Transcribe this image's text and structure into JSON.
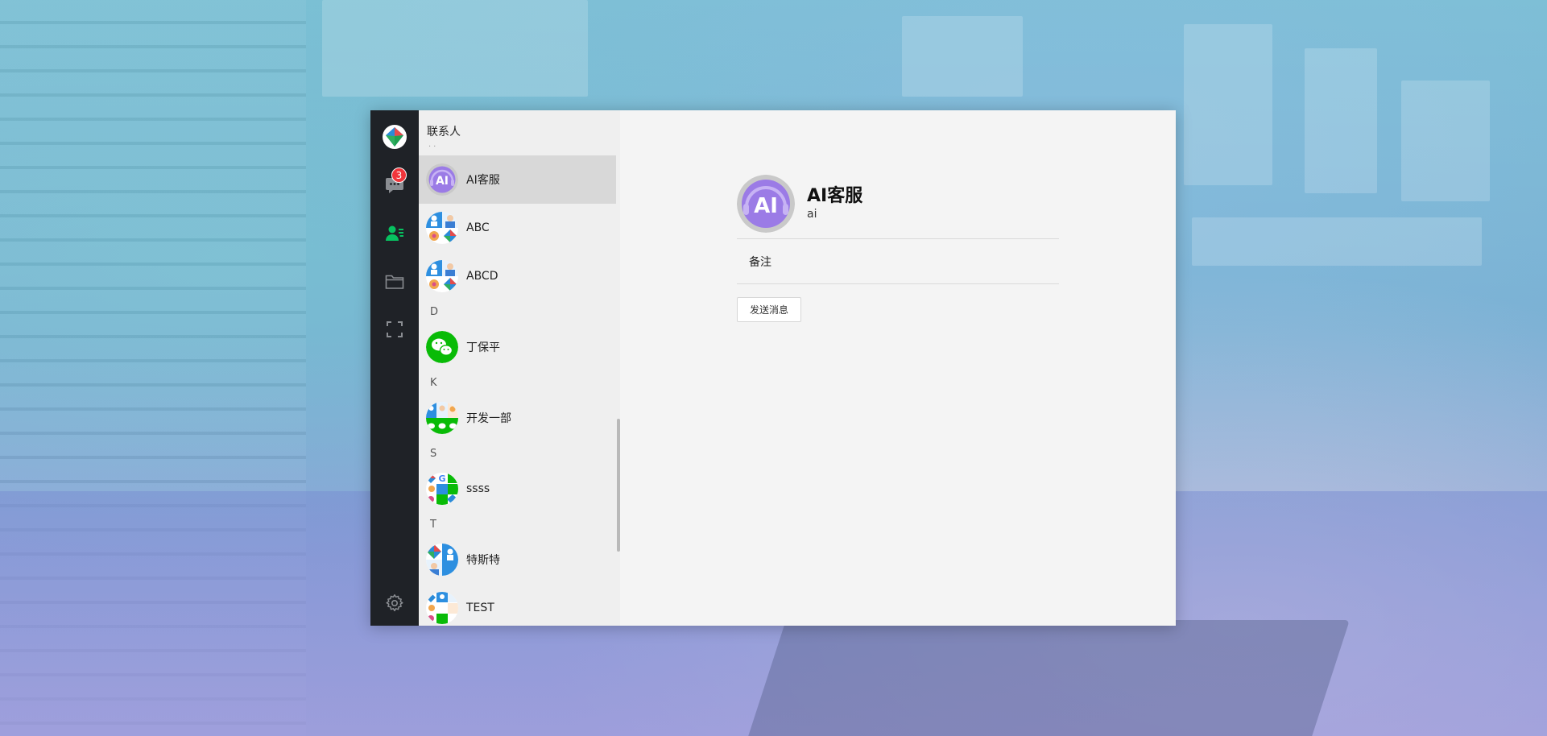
{
  "colors": {
    "nav_bg": "#1f2227",
    "accent_green": "#07c160",
    "badge_red": "#f0353b",
    "list_bg": "#efefef",
    "active_row": "#d8d8d8",
    "detail_bg": "#f4f4f4",
    "ai_purple": "#9b7be6"
  },
  "nav": {
    "items": [
      {
        "icon": "app-logo-icon"
      },
      {
        "icon": "chat-bubble-icon",
        "badge": "3"
      },
      {
        "icon": "contacts-icon",
        "active": true
      },
      {
        "icon": "folder-icon"
      },
      {
        "icon": "fullscreen-icon"
      },
      {
        "icon": "gear-icon"
      }
    ]
  },
  "contacts": {
    "title": "联系人",
    "groups": [
      {
        "letter": "",
        "items": [
          {
            "name": "AI客服",
            "avatar": "ai-avatar",
            "active": true
          },
          {
            "name": "ABC",
            "avatar": "group-avatar"
          },
          {
            "name": "ABCD",
            "avatar": "group-avatar"
          }
        ]
      },
      {
        "letter": "D",
        "items": [
          {
            "name": "丁保平",
            "avatar": "wechat-avatar"
          }
        ]
      },
      {
        "letter": "K",
        "items": [
          {
            "name": "开发一部",
            "avatar": "group-avatar"
          }
        ]
      },
      {
        "letter": "S",
        "items": [
          {
            "name": "ssss",
            "avatar": "group-avatar"
          }
        ]
      },
      {
        "letter": "T",
        "items": [
          {
            "name": "特斯特",
            "avatar": "group-avatar"
          },
          {
            "name": "TEST",
            "avatar": "group-avatar"
          }
        ]
      }
    ]
  },
  "detail": {
    "name": "AI客服",
    "account": "ai",
    "remark_label": "备注",
    "send_button": "发送消息",
    "avatar_text": "AI"
  }
}
